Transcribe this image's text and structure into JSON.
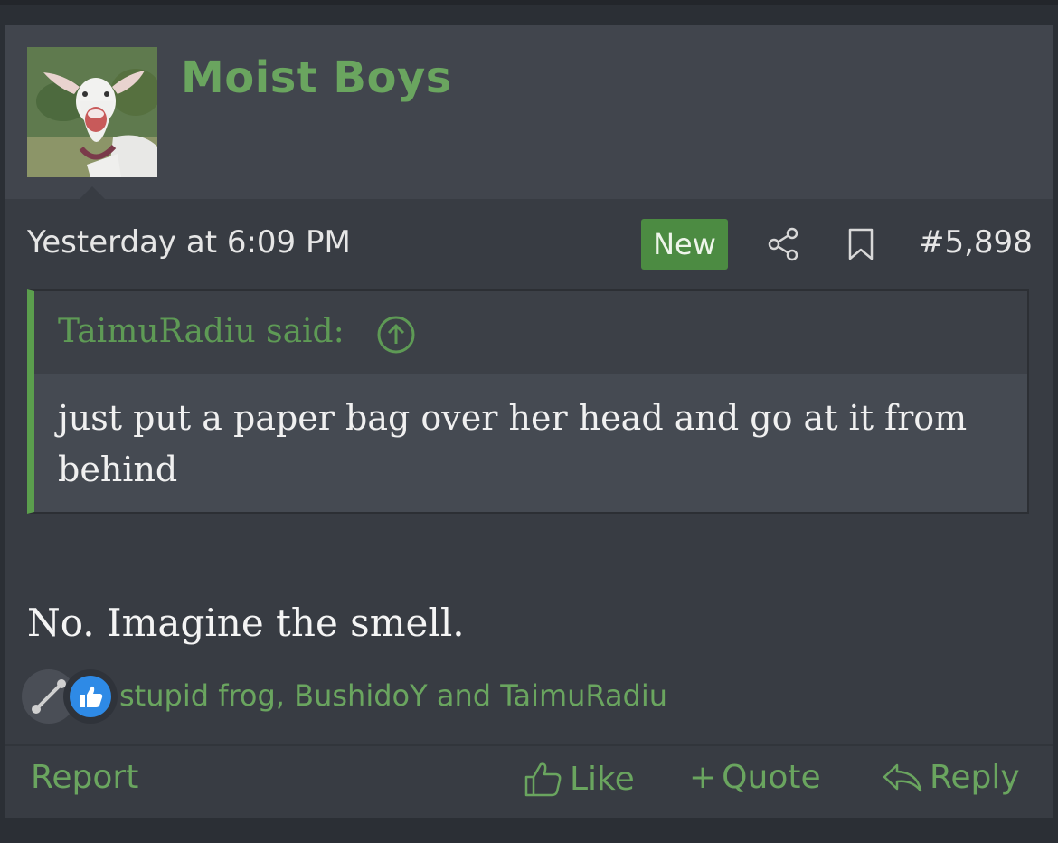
{
  "post": {
    "username": "Moist Boys",
    "timestamp": "Yesterday at 6:09 PM",
    "new_badge": "New",
    "post_number": "#5,898",
    "quote": {
      "author": "TaimuRadiu said:",
      "text": "just put a paper bag over her head and go at it from behind"
    },
    "message": "No. Imagine the smell.",
    "reactions": {
      "users": "stupid frog, BushidoY and TaimuRadiu"
    },
    "footer": {
      "report": "Report",
      "like": "Like",
      "quote": "Quote",
      "quote_prefix": "+",
      "reply": "Reply"
    }
  },
  "colors": {
    "accent": "#6aa55f",
    "badge": "#4c8b42",
    "background": "#383c43",
    "header": "#41454d"
  },
  "icons": [
    "share-icon",
    "bookmark-icon",
    "arrow-up-circle-icon",
    "link-reaction-icon",
    "like-reaction-icon",
    "thumbs-up-icon",
    "reply-icon"
  ]
}
